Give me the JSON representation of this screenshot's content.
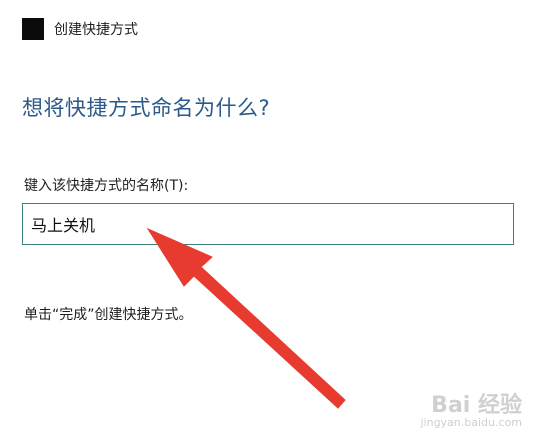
{
  "window": {
    "title": "创建快捷方式",
    "icon": "app-icon"
  },
  "page": {
    "heading": "想将快捷方式命名为什么?",
    "field_label": "键入该快捷方式的名称(T):",
    "input_value": "马上关机",
    "hint": "单击“完成”创建快捷方式。"
  },
  "annotation": {
    "arrow_color": "#e83b2f"
  },
  "watermark": {
    "main": "Bai 经验",
    "sub": "jingyan.baidu.com"
  }
}
